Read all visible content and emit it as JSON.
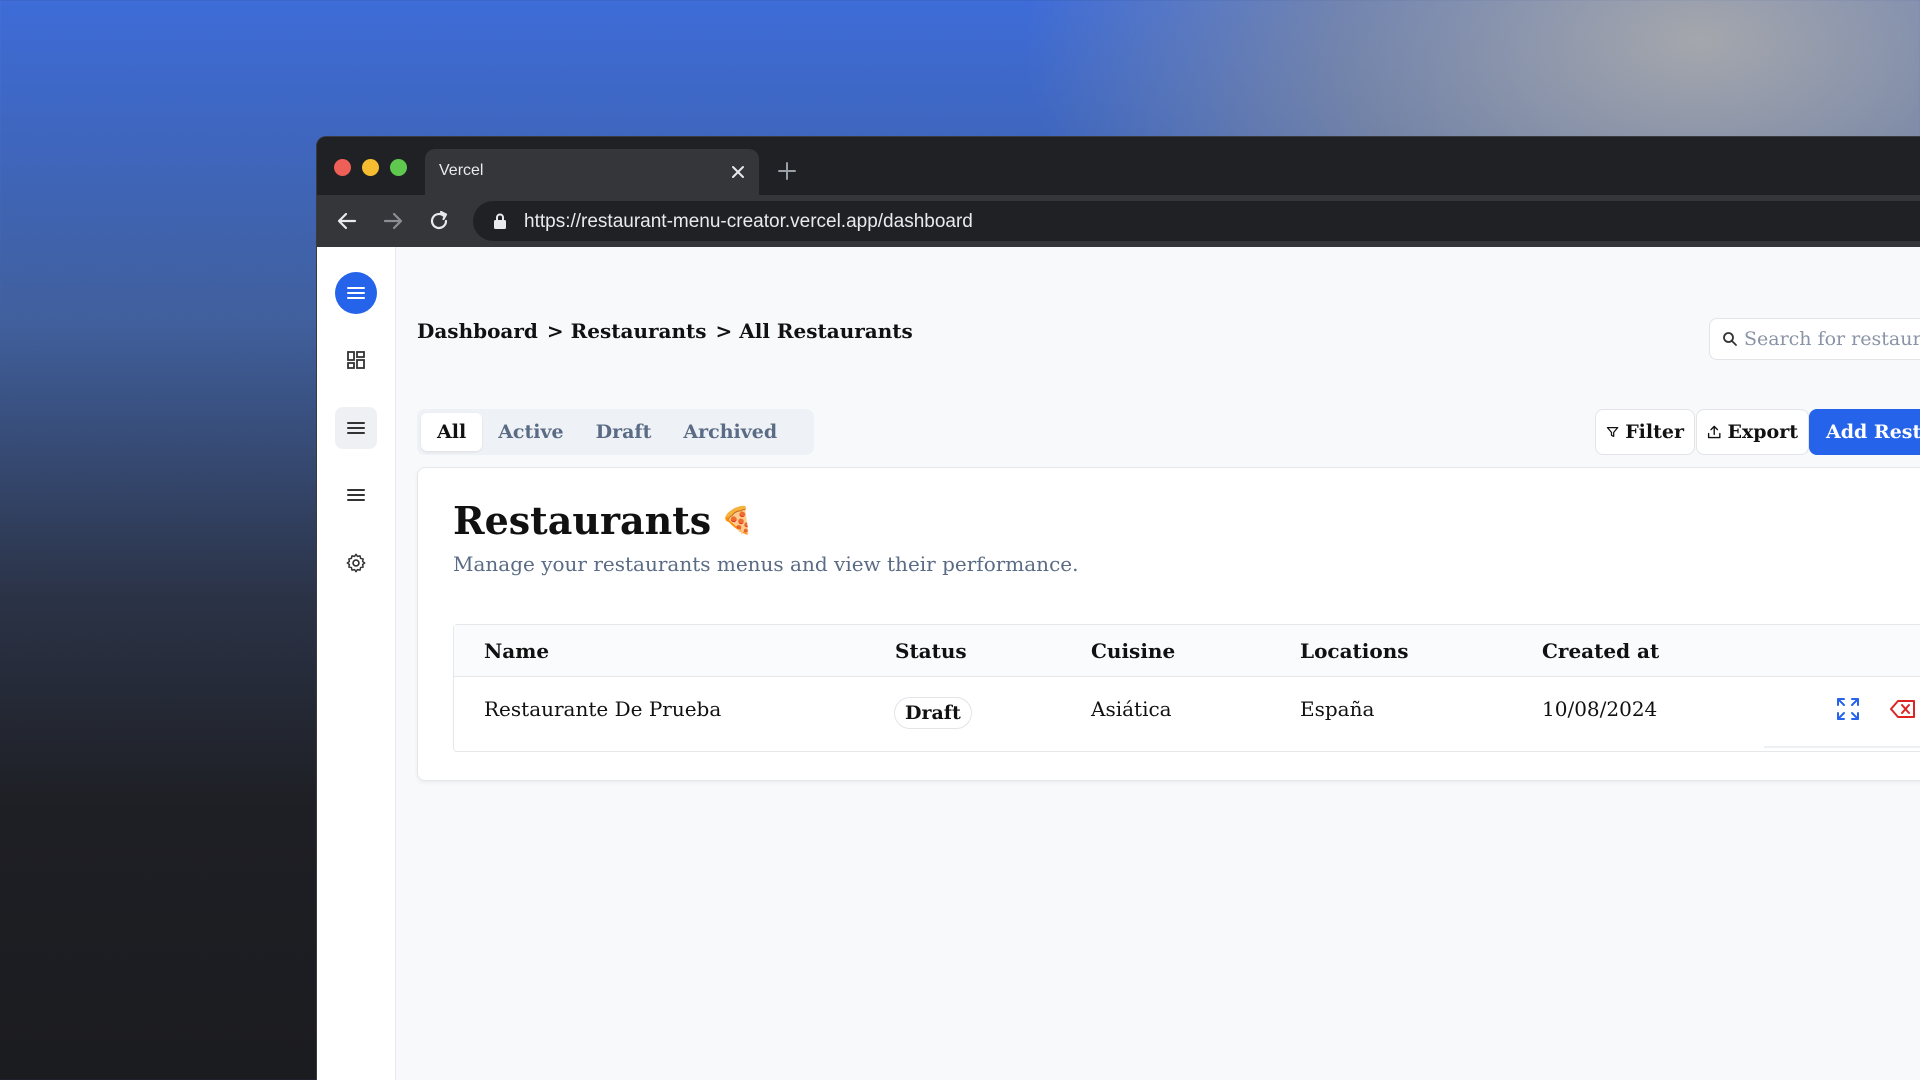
{
  "browser": {
    "tab_title": "Vercel",
    "url": "https://restaurant-menu-creator.vercel.app/dashboard"
  },
  "sidebar": {
    "items": [
      {
        "icon": "menu-icon"
      },
      {
        "icon": "dashboard-icon"
      },
      {
        "icon": "list-icon"
      },
      {
        "icon": "list-icon"
      },
      {
        "icon": "gear-icon"
      }
    ]
  },
  "breadcrumb": {
    "item1": "Dashboard",
    "item2": "> Restaurants",
    "item3": "> All Restaurants"
  },
  "search": {
    "placeholder": "Search for restaurants..."
  },
  "tabs": {
    "all": "All",
    "active": "Active",
    "draft": "Draft",
    "archived": "Archived"
  },
  "actions": {
    "filter": "Filter",
    "export": "Export",
    "add": "Add Restaurant"
  },
  "page": {
    "title": "Restaurants",
    "title_emoji": "🍕",
    "subtitle": "Manage your restaurants menus and view their performance."
  },
  "table": {
    "headers": {
      "name": "Name",
      "status": "Status",
      "cuisine": "Cuisine",
      "locations": "Locations",
      "created_at": "Created at"
    },
    "rows": [
      {
        "name": "Restaurante De Prueba",
        "status": "Draft",
        "cuisine": "Asiática",
        "locations": "España",
        "created_at": "10/08/2024"
      }
    ]
  },
  "colors": {
    "accent": "#2563eb",
    "danger": "#dc2626",
    "muted": "#5a6b85"
  }
}
